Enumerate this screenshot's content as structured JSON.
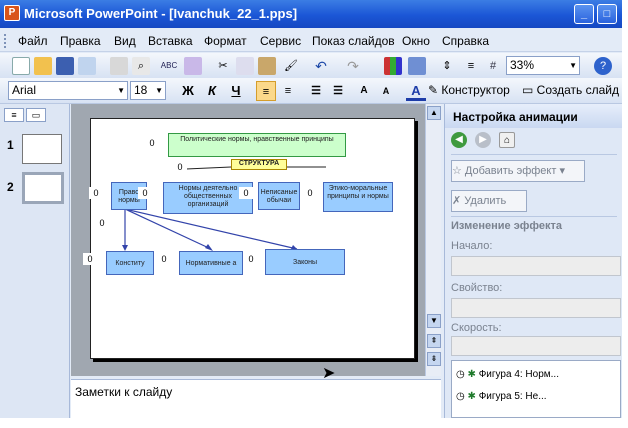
{
  "window": {
    "title": "Microsoft PowerPoint - [Ivanchuk_22_1.pps]",
    "app_icon": "P",
    "controls": [
      "_",
      "□"
    ]
  },
  "menu": [
    "Файл",
    "Правка",
    "Вид",
    "Вставка",
    "Формат",
    "Сервис",
    "Показ слайдов",
    "Окно",
    "Справка"
  ],
  "toolbar": {
    "zoom": "33%",
    "icons": [
      "new-icon",
      "open-icon",
      "save-icon",
      "permission-icon",
      "email-icon",
      "print-icon",
      "print-preview-icon",
      "spelling-icon",
      "research-icon",
      "cut-icon",
      "copy-icon",
      "paste-icon",
      "format-painter-icon",
      "undo-icon",
      "redo-icon",
      "chart-icon",
      "table-icon",
      "expand-icon",
      "grid-icon"
    ]
  },
  "format_bar": {
    "font": "Arial",
    "size": "18",
    "bold": "Ж",
    "italic": "К",
    "underline": "Ч",
    "font_color_letter": "A",
    "designer": "Конструктор",
    "new_slide": "Создать слайд"
  },
  "slides_pane": {
    "slide_numbers": [
      "1",
      "2"
    ]
  },
  "slide": {
    "zero": "0",
    "shapes": {
      "top": "Политические нормы, нравственные принципы",
      "structure": "СТРУКТУРА",
      "pravo": "Право нормы",
      "normy": "Нормы деятельно общественных организаций",
      "nepisan": "Неписаные обычаи",
      "etiko": "Этико-моральные принципы и нормы",
      "constit": "Конститу",
      "normativ": "Нормативные а",
      "zakony": "Законы"
    }
  },
  "notes": {
    "placeholder": "Заметки к слайду"
  },
  "task_pane": {
    "title": "Настройка анимации",
    "add_effect": "Добавить эффект",
    "remove": "Удалить",
    "change_effect": "Изменение эффекта",
    "start_label": "Начало:",
    "property_label": "Свойство:",
    "speed_label": "Скорость:",
    "items": [
      "Фигура 4: Норм...",
      "Фигура 5: Не..."
    ]
  }
}
